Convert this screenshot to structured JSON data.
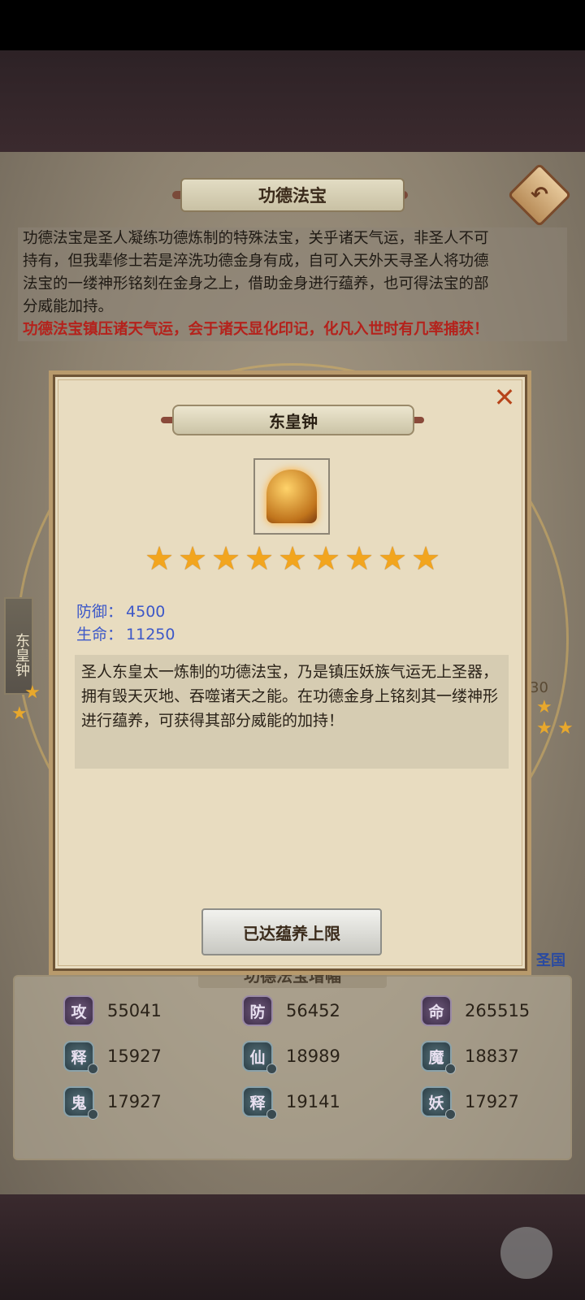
{
  "header": {
    "title": "功德法宝",
    "back_icon": "back-arrow-icon"
  },
  "intro": {
    "lines": [
      "功德法宝是圣人凝练功德炼制的特殊法宝，关乎诸天气运，非圣人不可",
      "持有，但我辈修士若是淬洗功德金身有成，自可入天外天寻圣人将功德",
      "法宝的一缕神形铭刻在金身之上，借助金身进行蕴养，也可得法宝的部",
      "分威能加持。"
    ],
    "highlight": "功德法宝镇压诸天气运，会于诸天显化印记，化凡入世时有几率捕获！"
  },
  "background": {
    "side_tag": "东皇钟",
    "partial_value": "30",
    "partial_link": "圣国"
  },
  "stats_panel": {
    "title": "功德法宝增幅",
    "items": [
      {
        "glyph": "攻",
        "value": "55041",
        "badge": false
      },
      {
        "glyph": "防",
        "value": "56452",
        "badge": false
      },
      {
        "glyph": "命",
        "value": "265515",
        "badge": false
      },
      {
        "glyph": "释",
        "value": "15927",
        "badge": true
      },
      {
        "glyph": "仙",
        "value": "18989",
        "badge": true
      },
      {
        "glyph": "魔",
        "value": "18837",
        "badge": true
      },
      {
        "glyph": "鬼",
        "value": "17927",
        "badge": true
      },
      {
        "glyph": "释",
        "value": "19141",
        "badge": true
      },
      {
        "glyph": "妖",
        "value": "17927",
        "badge": true
      }
    ]
  },
  "modal": {
    "item_name": "东皇钟",
    "close_icon": "close-x-icon",
    "item_icon": "golden-bell-icon",
    "stars": 9,
    "attrs": [
      {
        "label": "防御：",
        "value": "4500"
      },
      {
        "label": "生命：",
        "value": "11250"
      }
    ],
    "description": "圣人东皇太一炼制的功德法宝，乃是镇压妖族气运无上圣器，拥有毁天灭地、吞噬诸天之能。在功德金身上铭刻其一缕神形进行蕴养，可获得其部分威能的加持！",
    "action_label": "已达蕴养上限"
  },
  "colors": {
    "accent_red": "#b4221c",
    "attr_blue": "#3d58c8",
    "star_gold": "#f2a51e",
    "close_orange": "#b7441a"
  }
}
